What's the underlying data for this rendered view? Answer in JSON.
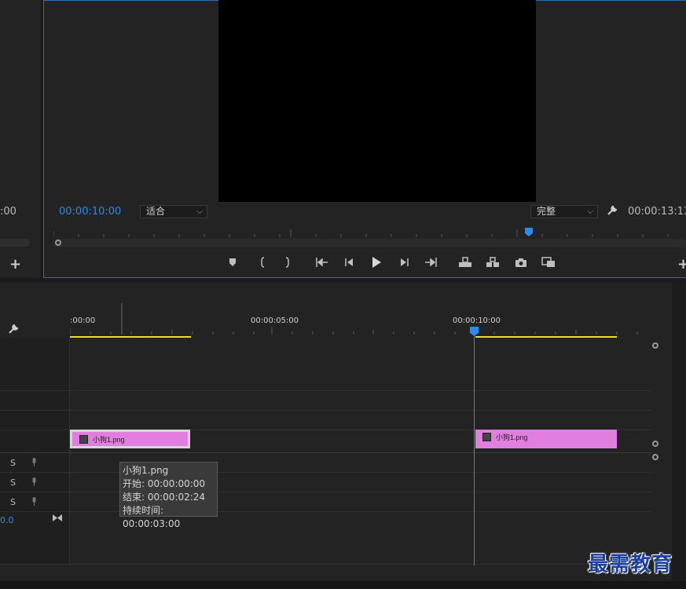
{
  "left_panel": {
    "timecode": ":00",
    "plus": "+"
  },
  "program_monitor": {
    "current_timecode": "00:00:10:00",
    "fit_select": "适合",
    "quality_select": "完整",
    "duration_timecode": "00:00:13:13",
    "plus": "+"
  },
  "transport_icons": [
    "marker-icon",
    "mark-in-icon",
    "mark-out-icon",
    "go-to-in-icon",
    "step-back-icon",
    "play-icon",
    "step-forward-icon",
    "go-to-out-icon",
    "lift-icon",
    "extract-icon",
    "camera-icon",
    "comparison-view-icon"
  ],
  "timeline": {
    "ruler_labels": [
      ":00:00",
      "00:00:05:00",
      "00:00:10:00"
    ],
    "clips": [
      {
        "label": "小狗1.png"
      },
      {
        "label": "小狗1.png"
      }
    ],
    "tooltip": {
      "name": "小狗1.png",
      "start": "开始: 00:00:00:00",
      "end": "结束: 00:00:02:24",
      "duration": "持续时间: 00:00:03:00"
    },
    "solo_labels": [
      "S",
      "S",
      "S"
    ],
    "volume_value": "0.0"
  },
  "watermark": "最需教育",
  "colors": {
    "accent": "#2d8ceb",
    "clip": "#e07fe0",
    "work_area": "#e8e020"
  }
}
